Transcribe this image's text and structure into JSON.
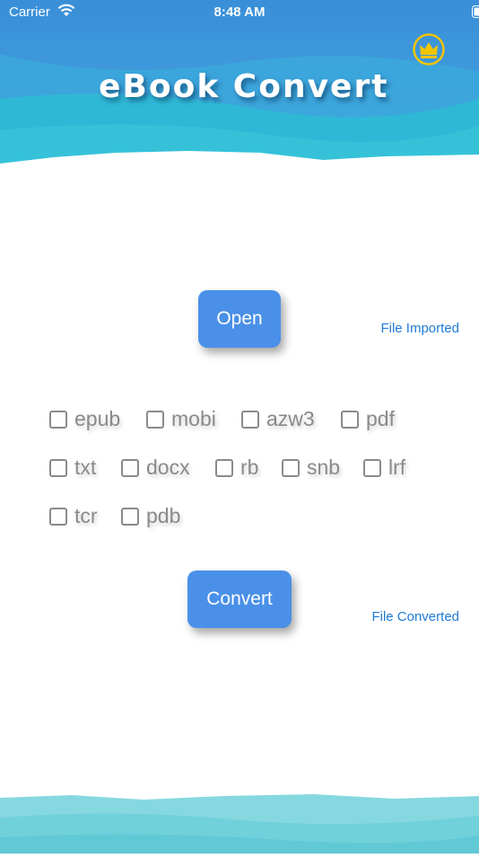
{
  "status_bar": {
    "carrier": "Carrier",
    "time": "8:48 AM"
  },
  "header": {
    "title": "eBook Convert"
  },
  "actions": {
    "open_label": "Open",
    "convert_label": "Convert"
  },
  "status": {
    "imported": "File Imported",
    "converted": "File Converted"
  },
  "formats": [
    {
      "label": "epub",
      "checked": false
    },
    {
      "label": "mobi",
      "checked": false
    },
    {
      "label": "azw3",
      "checked": false
    },
    {
      "label": "pdf",
      "checked": false
    },
    {
      "label": "txt",
      "checked": false
    },
    {
      "label": "docx",
      "checked": false
    },
    {
      "label": "rb",
      "checked": false
    },
    {
      "label": "snb",
      "checked": false
    },
    {
      "label": "lrf",
      "checked": false
    },
    {
      "label": "tcr",
      "checked": false
    },
    {
      "label": "pdb",
      "checked": false
    }
  ],
  "colors": {
    "header_top": "#3a8fd8",
    "header_wave": "#2fb8d6",
    "button": "#4a90e8",
    "link": "#1e7ad6",
    "crown": "#f2c400"
  },
  "icons": {
    "wifi": "wifi-icon",
    "battery": "battery-icon",
    "crown": "crown-icon"
  }
}
